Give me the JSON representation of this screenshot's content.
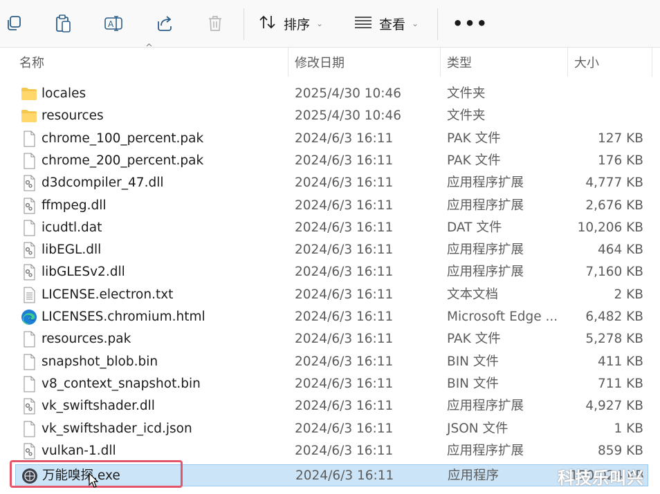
{
  "toolbar": {
    "sort_label": "排序",
    "view_label": "查看",
    "more_label": "•••"
  },
  "columns": {
    "name": "名称",
    "date": "修改日期",
    "type": "类型",
    "size": "大小"
  },
  "files": [
    {
      "name": "locales",
      "date": "2025/4/30 10:46",
      "type": "文件夹",
      "size": "",
      "icon": "folder-icon"
    },
    {
      "name": "resources",
      "date": "2025/4/30 10:46",
      "type": "文件夹",
      "size": "",
      "icon": "folder-icon"
    },
    {
      "name": "chrome_100_percent.pak",
      "date": "2024/6/3 16:11",
      "type": "PAK 文件",
      "size": "127 KB",
      "icon": "file-icon"
    },
    {
      "name": "chrome_200_percent.pak",
      "date": "2024/6/3 16:11",
      "type": "PAK 文件",
      "size": "176 KB",
      "icon": "file-icon"
    },
    {
      "name": "d3dcompiler_47.dll",
      "date": "2024/6/3 16:11",
      "type": "应用程序扩展",
      "size": "4,777 KB",
      "icon": "dll-icon"
    },
    {
      "name": "ffmpeg.dll",
      "date": "2024/6/3 16:11",
      "type": "应用程序扩展",
      "size": "2,676 KB",
      "icon": "dll-icon"
    },
    {
      "name": "icudtl.dat",
      "date": "2024/6/3 16:11",
      "type": "DAT 文件",
      "size": "10,206 KB",
      "icon": "file-icon"
    },
    {
      "name": "libEGL.dll",
      "date": "2024/6/3 16:11",
      "type": "应用程序扩展",
      "size": "464 KB",
      "icon": "dll-icon"
    },
    {
      "name": "libGLESv2.dll",
      "date": "2024/6/3 16:11",
      "type": "应用程序扩展",
      "size": "7,160 KB",
      "icon": "dll-icon"
    },
    {
      "name": "LICENSE.electron.txt",
      "date": "2024/6/3 16:11",
      "type": "文本文档",
      "size": "2 KB",
      "icon": "text-file-icon"
    },
    {
      "name": "LICENSES.chromium.html",
      "date": "2024/6/3 16:11",
      "type": "Microsoft Edge ...",
      "size": "6,482 KB",
      "icon": "edge-icon"
    },
    {
      "name": "resources.pak",
      "date": "2024/6/3 16:11",
      "type": "PAK 文件",
      "size": "5,278 KB",
      "icon": "file-icon"
    },
    {
      "name": "snapshot_blob.bin",
      "date": "2024/6/3 16:11",
      "type": "BIN 文件",
      "size": "411 KB",
      "icon": "file-icon"
    },
    {
      "name": "v8_context_snapshot.bin",
      "date": "2024/6/3 16:11",
      "type": "BIN 文件",
      "size": "711 KB",
      "icon": "file-icon"
    },
    {
      "name": "vk_swiftshader.dll",
      "date": "2024/6/3 16:11",
      "type": "应用程序扩展",
      "size": "4,927 KB",
      "icon": "dll-icon"
    },
    {
      "name": "vk_swiftshader_icd.json",
      "date": "2024/6/3 16:11",
      "type": "JSON 文件",
      "size": "1 KB",
      "icon": "file-icon"
    },
    {
      "name": "vulkan-1.dll",
      "date": "2024/6/3 16:11",
      "type": "应用程序扩展",
      "size": "859 KB",
      "icon": "dll-icon"
    },
    {
      "name": "万能嗅探.exe",
      "date": "2024/6/3 16:11",
      "type": "应用程序",
      "size": "150,024 KB",
      "icon": "app-icon",
      "selected": true
    }
  ],
  "watermark": "科技乐叫兴"
}
